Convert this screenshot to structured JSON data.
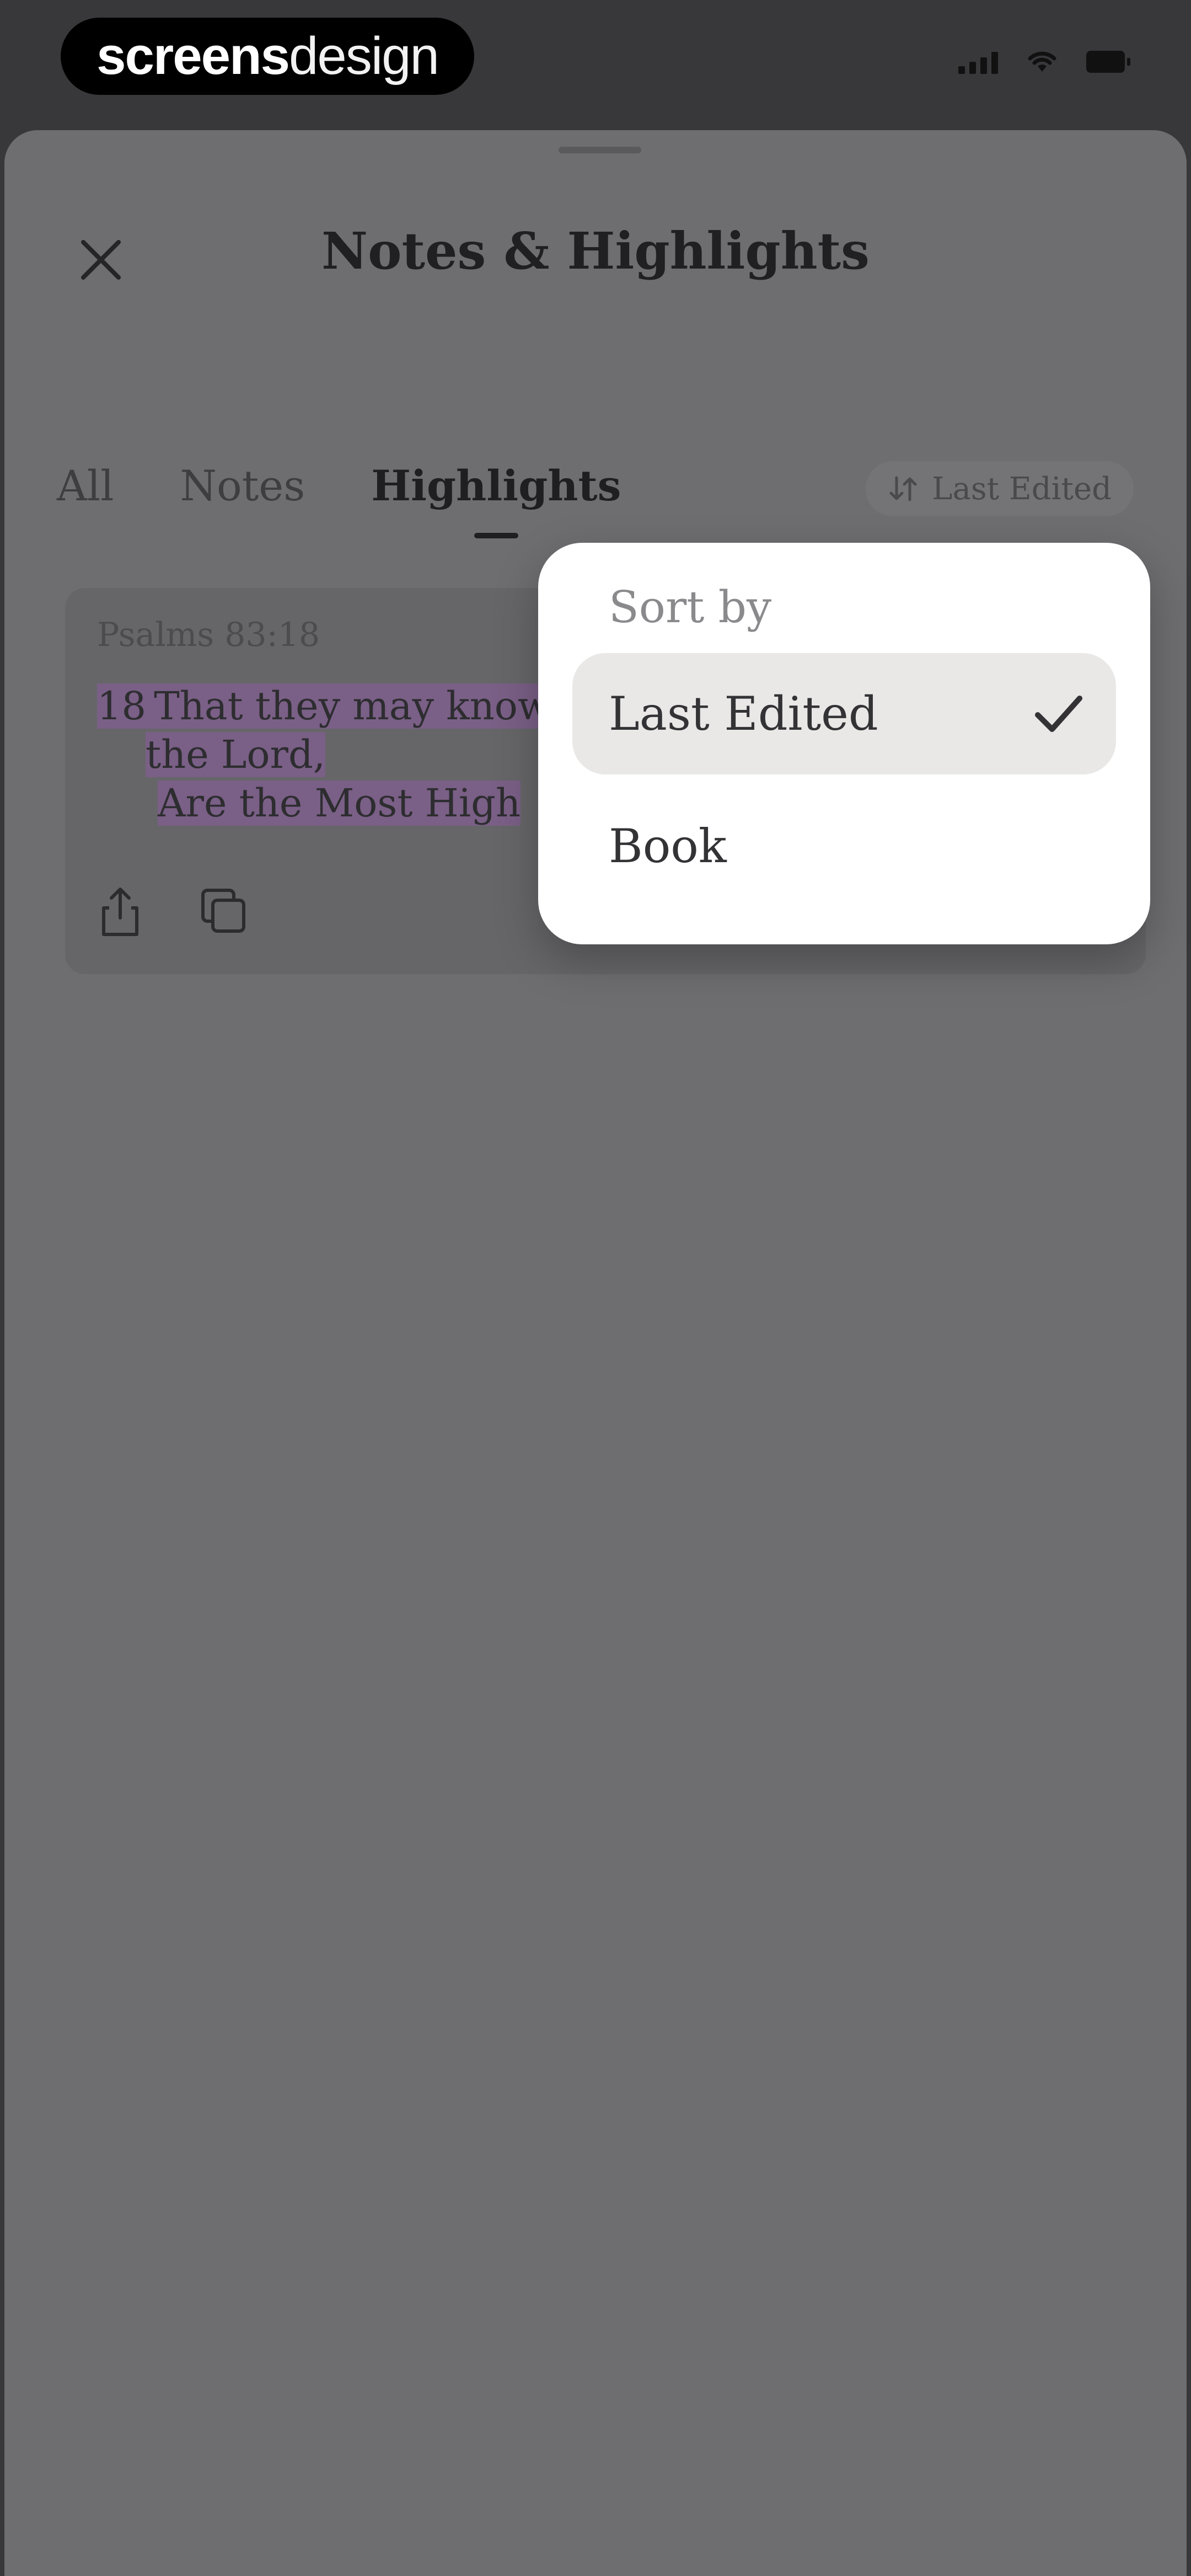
{
  "status_bar": {
    "brand_bold": "screens",
    "brand_light": "design",
    "icons": [
      "signal-icon",
      "wifi-icon",
      "battery-icon"
    ]
  },
  "sheet": {
    "title": "Notes & Highlights",
    "close_icon": "close-icon",
    "tabs": [
      {
        "label": "All"
      },
      {
        "label": "Notes"
      },
      {
        "label": "Highlights",
        "active": true
      }
    ],
    "sort_button_label": "Last Edited",
    "sort_icon": "sort-arrows-icon"
  },
  "card": {
    "reference": "Psalms 83:18",
    "verse_number": "18",
    "line1": "That they may know t",
    "line2": "the Lord,",
    "line3": "Are the Most High",
    "actions": [
      "share-icon",
      "copy-icon"
    ],
    "highlight_color": "#7a5f86"
  },
  "popover": {
    "title": "Sort by",
    "options": [
      {
        "label": "Last Edited",
        "selected": true
      },
      {
        "label": "Book",
        "selected": false
      }
    ],
    "check_icon": "checkmark-icon"
  }
}
